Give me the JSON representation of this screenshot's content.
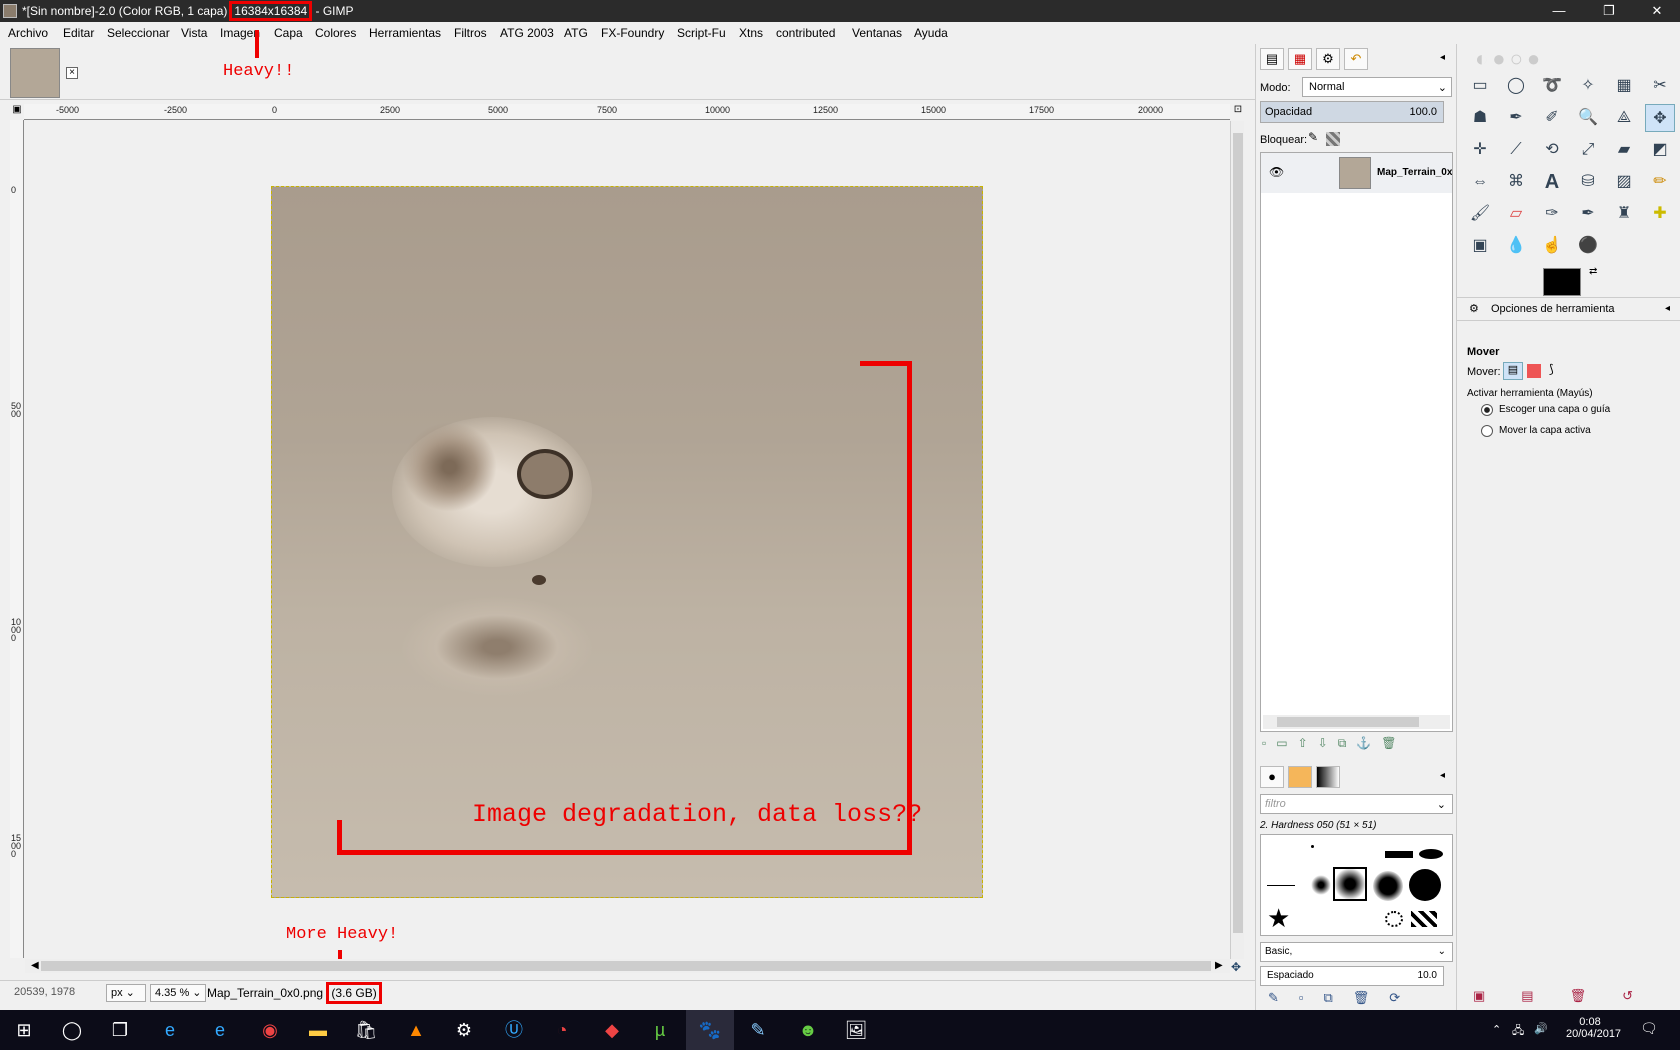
{
  "window": {
    "title_prefix": "*[Sin nombre]-2.0 (Color RGB, 1 capa)",
    "title_size": "16384x16384",
    "title_suffix": "- GIMP",
    "minimize": "—",
    "restore": "❐",
    "close": "✕"
  },
  "menu": [
    "Archivo",
    "Editar",
    "Seleccionar",
    "Vista",
    "Imagen",
    "Capa",
    "Colores",
    "Herramientas",
    "Filtros",
    "ATG 2003",
    "ATG",
    "FX-Foundry",
    "Script-Fu",
    "Xtns",
    "contributed",
    "Ventanas",
    "Ayuda"
  ],
  "image_tab": {
    "close": "×"
  },
  "ruler": {
    "h_labels": [
      "-5000",
      "-2500",
      "0",
      "2500",
      "5000",
      "7500",
      "10000",
      "12500",
      "15000",
      "17500",
      "20000"
    ],
    "v_labels": [
      "0",
      "5000",
      "10000",
      "15000"
    ]
  },
  "annotations": {
    "heavy": "Heavy!!",
    "more_heavy": "More Heavy!",
    "degradation": "Image degradation, data loss??"
  },
  "status": {
    "coords": "20539, 1978",
    "unit": "px",
    "zoom": "4.35 %",
    "file": "Map_Terrain_0x0.png",
    "size": "(3.6 GB)"
  },
  "layers": {
    "mode_label": "Modo:",
    "mode_value": "Normal",
    "opacity_label": "Opacidad",
    "opacity_value": "100.0",
    "lock_label": "Bloquear:",
    "layer_name": "Map_Terrain_0x"
  },
  "brushes": {
    "filter_placeholder": "filtro",
    "brush_name": "2. Hardness 050 (51 × 51)",
    "preset": "Basic,",
    "spacing_label": "Espaciado",
    "spacing_value": "10.0"
  },
  "tool_options": {
    "tab_title": "Opciones de herramienta",
    "tool_name": "Mover",
    "move_label": "Mover:",
    "activate_label": "Activar herramienta  (Mayús)",
    "option1": "Escoger una capa o guía",
    "option2": "Mover la capa activa"
  },
  "taskbar": {
    "time": "0:08",
    "date": "20/04/2017"
  },
  "colors": {
    "accent_red": "#e00000",
    "selected_tool": "#cfe3f7"
  }
}
